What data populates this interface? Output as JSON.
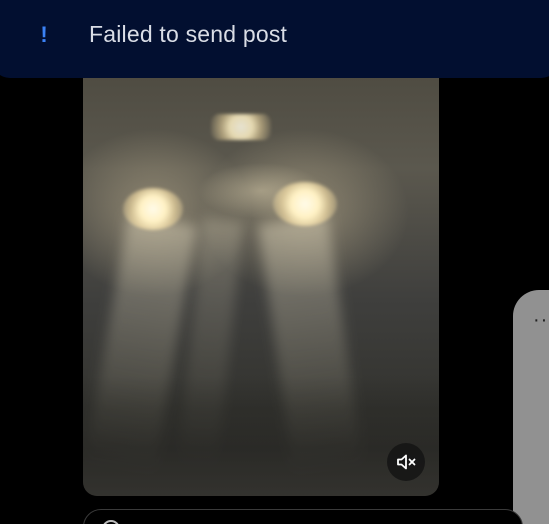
{
  "toast": {
    "icon": "exclamation-icon",
    "message": "Failed to send post",
    "accent_color": "#3b82f6",
    "background_color": "#020f30"
  },
  "video": {
    "mute_icon": "speaker-muted-icon",
    "muted": true
  },
  "side_card": {
    "icon": "more-dots-icon",
    "glyph": "··"
  },
  "toast_glyph": "!"
}
